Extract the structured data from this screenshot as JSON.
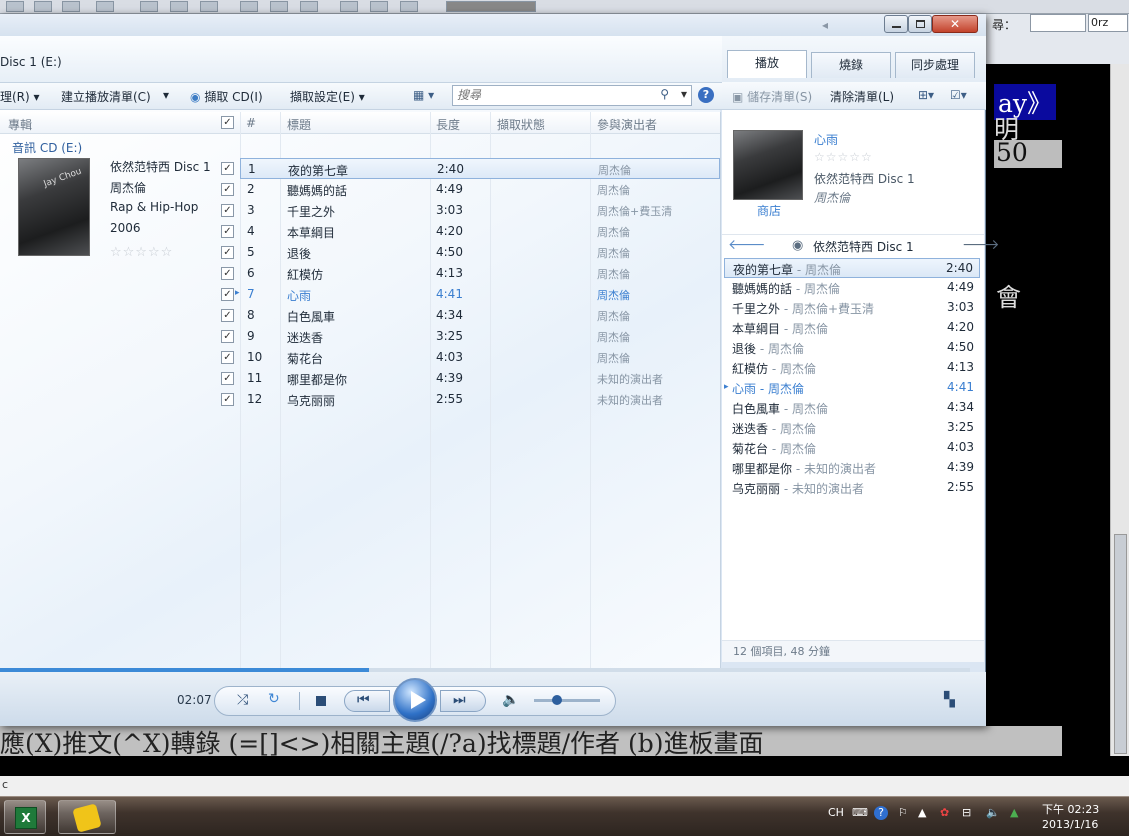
{
  "background_app": {
    "search_label": "尋：",
    "zoom_value": "0rz",
    "terminal_line1": "ay》",
    "terminal_line2": "明",
    "terminal_line3": "50",
    "terminal_line4": "會",
    "bottom_line": "應(X)推文(^X)轉錄 (=[]<>)相關主題(/?a)找標題/作者 (b)進板畫面",
    "status_char": "c"
  },
  "wmp": {
    "breadcrumb": "Disc 1 (E:)",
    "toolbar": {
      "organize": "理(R)",
      "create_playlist": "建立播放清單(C)",
      "rip_cd": "擷取 CD(I)",
      "rip_settings": "擷取設定(E)",
      "search_placeholder": "搜尋"
    },
    "columns": {
      "album": "專輯",
      "number": "#",
      "title": "標題",
      "length": "長度",
      "rip_status": "擷取狀態",
      "artist": "參與演出者"
    },
    "group_label": "音訊 CD (E:)",
    "album": {
      "name": "依然范特西 Disc 1",
      "artist": "周杰倫",
      "genre": "Rap & Hip-Hop",
      "year": "2006",
      "rating": "☆☆☆☆☆"
    },
    "tracks": [
      {
        "num": "1",
        "title": "夜的第七章",
        "length": "2:40",
        "artist": "周杰倫",
        "checked": "✓"
      },
      {
        "num": "2",
        "title": "聽媽媽的話",
        "length": "4:49",
        "artist": "周杰倫",
        "checked": "✓"
      },
      {
        "num": "3",
        "title": "千里之外",
        "length": "3:03",
        "artist": "周杰倫+費玉清",
        "checked": "✓"
      },
      {
        "num": "4",
        "title": "本草綱目",
        "length": "4:20",
        "artist": "周杰倫",
        "checked": "✓"
      },
      {
        "num": "5",
        "title": "退後",
        "length": "4:50",
        "artist": "周杰倫",
        "checked": "✓"
      },
      {
        "num": "6",
        "title": "紅模仿",
        "length": "4:13",
        "artist": "周杰倫",
        "checked": "✓"
      },
      {
        "num": "7",
        "title": "心雨",
        "length": "4:41",
        "artist": "周杰倫",
        "checked": "✓"
      },
      {
        "num": "8",
        "title": "白色風車",
        "length": "4:34",
        "artist": "周杰倫",
        "checked": "✓"
      },
      {
        "num": "9",
        "title": "迷迭香",
        "length": "3:25",
        "artist": "周杰倫",
        "checked": "✓"
      },
      {
        "num": "10",
        "title": "菊花台",
        "length": "4:03",
        "artist": "周杰倫",
        "checked": "✓"
      },
      {
        "num": "11",
        "title": "哪里都是你",
        "length": "4:39",
        "artist": "未知的演出者",
        "checked": "✓"
      },
      {
        "num": "12",
        "title": "乌克丽丽",
        "length": "2:55",
        "artist": "未知的演出者",
        "checked": "✓"
      }
    ],
    "playing_index": 7,
    "player": {
      "elapsed": "02:07",
      "progress_fraction": 0.38,
      "volume_fraction": 0.35
    },
    "right_pane": {
      "tabs": [
        "播放",
        "燒錄",
        "同步處理"
      ],
      "active_tab": "播放",
      "save_list": "儲存清單(S)",
      "clear_list": "清除清單(L)",
      "now_playing_title": "心雨",
      "now_playing_rating": "☆☆☆☆☆",
      "now_playing_album": "依然范特西 Disc 1",
      "now_playing_artist": "周杰倫",
      "store_link": "商店",
      "list_title": "依然范特西 Disc 1",
      "footer": "12 個項目, 48 分鐘"
    }
  },
  "taskbar": {
    "lang": "CH",
    "time": "下午 02:23",
    "date": "2013/1/16"
  }
}
